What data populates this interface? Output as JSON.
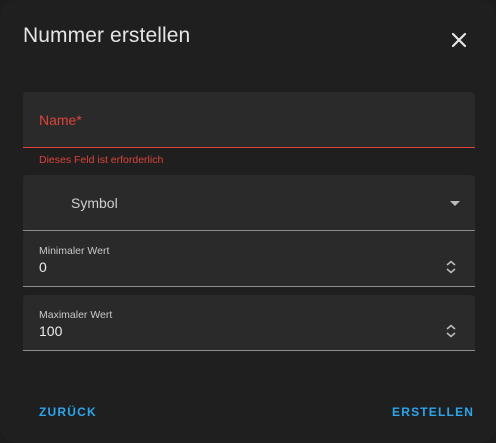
{
  "dialog": {
    "title": "Nummer erstellen"
  },
  "fields": {
    "name": {
      "label": "Name*",
      "error": "Dieses Feld ist erforderlich"
    },
    "symbol": {
      "label": "Symbol"
    },
    "min": {
      "label": "Minimaler Wert",
      "value": "0"
    },
    "max": {
      "label": "Maximaler Wert",
      "value": "100"
    }
  },
  "actions": {
    "back_label": "ZURÜCK",
    "create_label": "ERSTELLEN"
  },
  "icons": {
    "close": "close-icon",
    "dropdown": "chevron-down-icon",
    "spinner": "spinner-icon"
  },
  "colors": {
    "error": "#db4437",
    "accent": "#2aa6ee",
    "background": "#1f1f20",
    "field": "#2a2a2b"
  }
}
